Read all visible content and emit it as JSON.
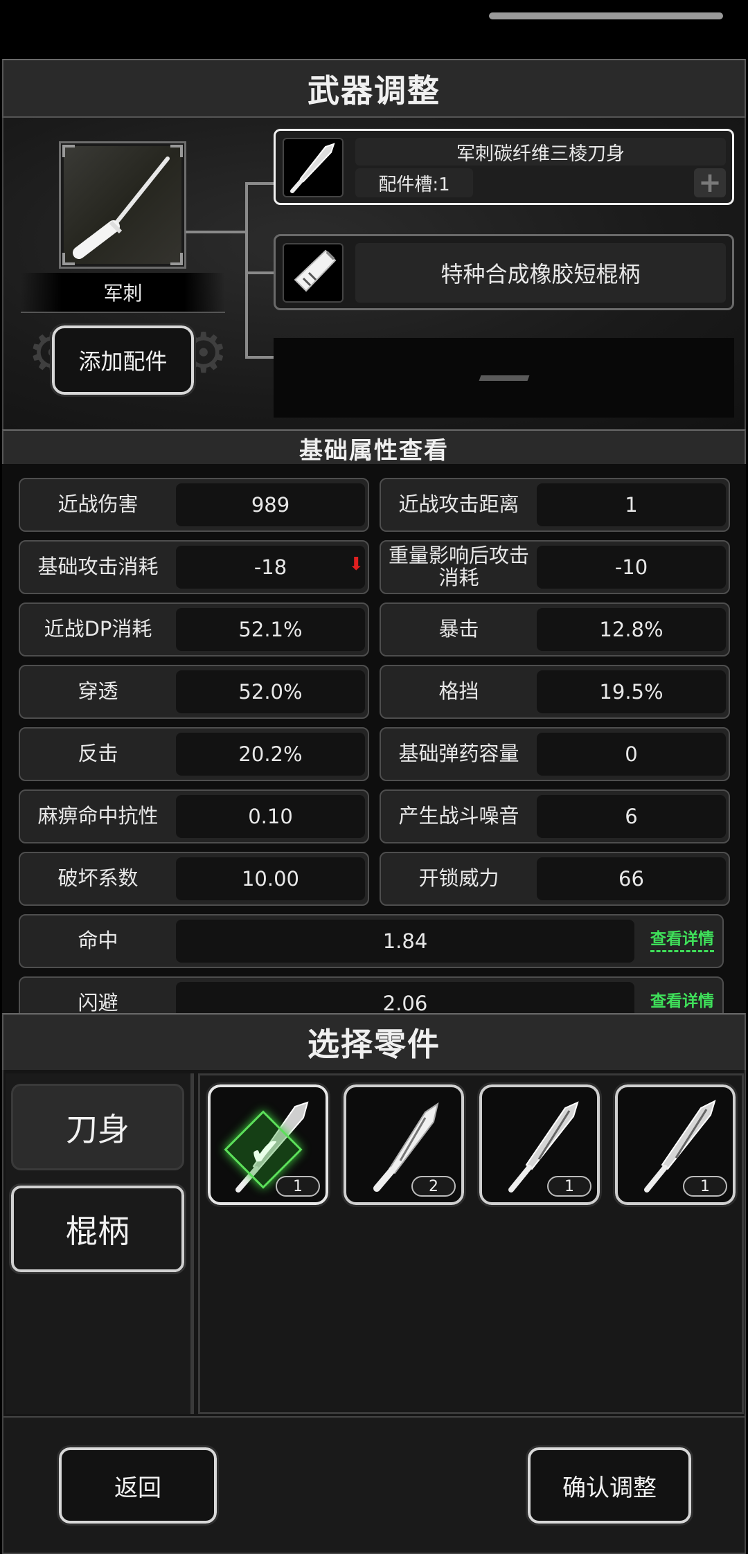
{
  "screen": {
    "title": "武器调整"
  },
  "weapon": {
    "name": "军刺",
    "icon": "bayonet-icon",
    "add_part_label": "添加配件"
  },
  "assembly": {
    "blade": {
      "name": "军刺碳纤维三棱刀身",
      "slot_label": "配件槽:1",
      "icon": "blade-icon"
    },
    "handle": {
      "name": "特种合成橡胶短棍柄",
      "icon": "rubber-handle-icon"
    }
  },
  "stats": {
    "title": "基础属性查看",
    "items": [
      {
        "label": "近战伤害",
        "value": "989"
      },
      {
        "label": "近战攻击距离",
        "value": "1"
      },
      {
        "label": "基础攻击消耗",
        "value": "-18"
      },
      {
        "label": "重量影响后攻击消耗",
        "value": "-10"
      },
      {
        "label": "近战DP消耗",
        "value": "52.1%"
      },
      {
        "label": "暴击",
        "value": "12.8%"
      },
      {
        "label": "穿透",
        "value": "52.0%"
      },
      {
        "label": "格挡",
        "value": "19.5%"
      },
      {
        "label": "反击",
        "value": "20.2%"
      },
      {
        "label": "基础弹药容量",
        "value": "0"
      },
      {
        "label": "麻痹命中抗性",
        "value": "0.10"
      },
      {
        "label": "产生战斗噪音",
        "value": "6"
      },
      {
        "label": "破坏系数",
        "value": "10.00"
      },
      {
        "label": "开锁威力",
        "value": "66"
      }
    ],
    "wide": [
      {
        "label": "命中",
        "value": "1.84",
        "link": "查看详情"
      },
      {
        "label": "闪避",
        "value": "2.06",
        "link": "查看详情"
      }
    ]
  },
  "parts": {
    "title": "选择零件",
    "categories": [
      {
        "label": "刀身"
      },
      {
        "label": "棍柄"
      }
    ],
    "items": [
      {
        "count": "1",
        "selected": true
      },
      {
        "count": "2",
        "selected": false
      },
      {
        "count": "1",
        "selected": false
      },
      {
        "count": "1",
        "selected": false
      }
    ]
  },
  "footer": {
    "back_label": "返回",
    "confirm_label": "确认调整"
  },
  "colors": {
    "accent_green": "#3fe05a",
    "alert_red": "#e02020"
  }
}
